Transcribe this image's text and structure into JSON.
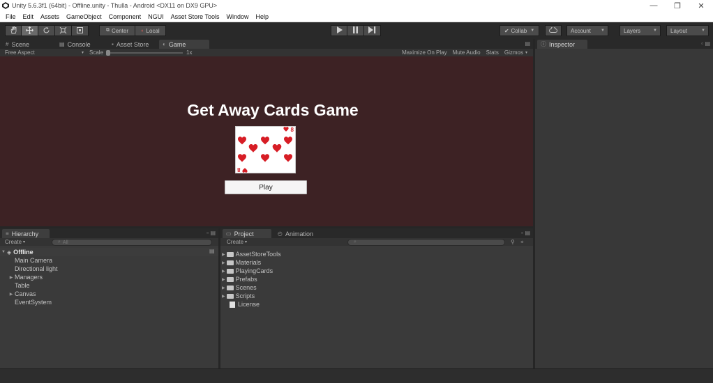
{
  "window": {
    "title": "Unity 5.6.3f1 (64bit) - Offline.unity - Thulla - Android <DX11 on DX9 GPU>",
    "controls": [
      "—",
      "❐",
      "✕"
    ]
  },
  "menu": [
    "File",
    "Edit",
    "Assets",
    "GameObject",
    "Component",
    "NGUI",
    "Asset Store Tools",
    "Window",
    "Help"
  ],
  "toolbar": {
    "pivot": "Center",
    "space": "Local",
    "collab": "Collab",
    "account": "Account",
    "layers": "Layers",
    "layout": "Layout"
  },
  "scene_tabs": {
    "scene": "Scene",
    "console": "Console",
    "asset_store": "Asset Store",
    "game": "Game"
  },
  "game_bar": {
    "aspect": "Free Aspect",
    "scale_label": "Scale",
    "scale_value": "1x",
    "maximize": "Maximize On Play",
    "mute": "Mute Audio",
    "stats": "Stats",
    "gizmos": "Gizmos"
  },
  "game": {
    "title": "Get Away Cards Game",
    "card_rank": "8",
    "play_button": "Play"
  },
  "inspector": {
    "tab": "Inspector"
  },
  "hierarchy": {
    "tab": "Hierarchy",
    "create": "Create",
    "search_placeholder": "All",
    "scene": "Offline",
    "items": [
      "Main Camera",
      "Directional light",
      "Managers",
      "Table",
      "Canvas",
      "EventSystem"
    ]
  },
  "project": {
    "tab": "Project",
    "animation_tab": "Animation",
    "create": "Create",
    "folders": [
      "AssetStoreTools",
      "Materials",
      "PlayingCards",
      "Prefabs",
      "Scenes",
      "Scripts"
    ],
    "files": [
      "License"
    ]
  },
  "colors": {
    "editor_bg": "#3a3a3a",
    "game_bg": "#3d2224",
    "heart_red": "#d71d25"
  }
}
